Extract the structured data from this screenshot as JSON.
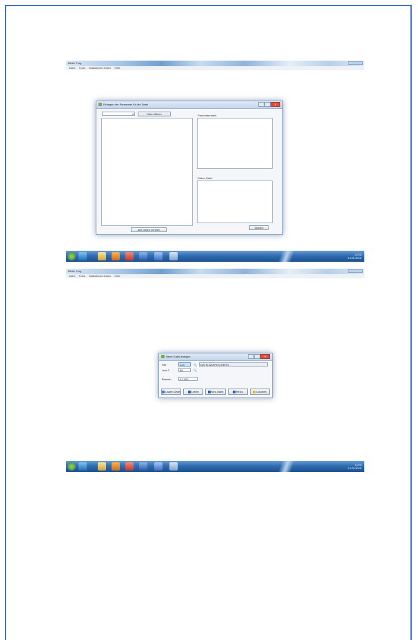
{
  "colors": {
    "frame_border": "#4472c4",
    "taskbar": "#2f6db3",
    "close_button": "#d9503f",
    "selection": "#cfe3f7"
  },
  "screenshot_1": {
    "window_title": "Biblio Prog",
    "menu": [
      "Datei",
      "Tools",
      "Statistische Daten",
      "Hilfe"
    ],
    "dialog": {
      "title": "Einlegen der Parameter für die Datei",
      "open_button": "Datei öffnen",
      "params_label": "Parameterdatei",
      "data_label": "Daten-Datei",
      "left_placeholder": "",
      "params_placeholder": "",
      "data_placeholder": "",
      "bottom_button": "Alle Daten senden",
      "run_button": "Starten"
    },
    "taskbar": {
      "clock_time": "12:00",
      "clock_date": "01.01.2012",
      "icons": [
        "start-orb-icon",
        "ie-icon",
        "explorer-icon",
        "media-icon",
        "app-red-icon",
        "word-icon",
        "app-blue-icon",
        "app-gear-icon"
      ]
    }
  },
  "screenshot_2": {
    "window_title": "Biblio Prog",
    "menu": [
      "Datei",
      "Tools",
      "Statistische Daten",
      "Hilfe"
    ],
    "dialog": {
      "title": "Neue Datei anlegen",
      "row1_label": "File",
      "row1_value": "123",
      "row1_extra": "DATEI ABSPEICHERN",
      "row2_label": "Line 2",
      "row2_value": "88",
      "row3_label": "Bereich",
      "row3_value": "0-1000",
      "buttons": [
        "Laden Datei",
        "Letzte",
        "Neu Datei",
        "Hinzu",
        "Löschen"
      ]
    },
    "taskbar": {
      "clock_time": "12:00",
      "clock_date": "01.01.2012"
    }
  }
}
